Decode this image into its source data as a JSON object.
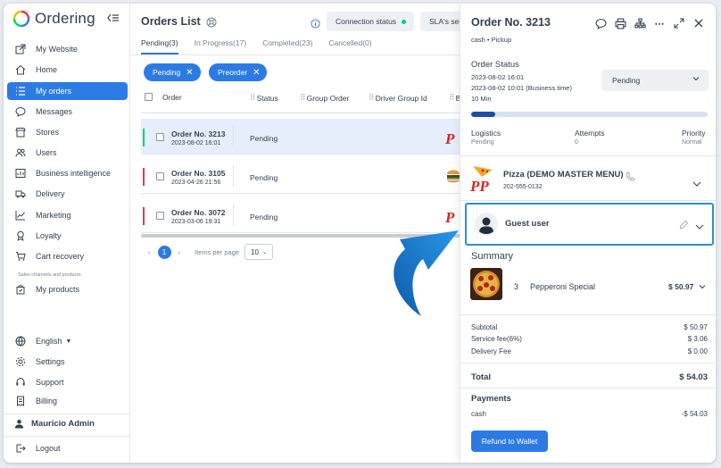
{
  "brand": {
    "name": "Ordering"
  },
  "sidebar": {
    "items": [
      {
        "label": "My Website",
        "icon": "external-link-icon"
      },
      {
        "label": "Home",
        "icon": "home-icon"
      },
      {
        "label": "My orders",
        "icon": "list-icon",
        "active": true
      },
      {
        "label": "Messages",
        "icon": "chat-icon"
      },
      {
        "label": "Stores",
        "icon": "shop-icon"
      },
      {
        "label": "Users",
        "icon": "users-icon"
      },
      {
        "label": "Business intelligence",
        "icon": "chart-icon"
      },
      {
        "label": "Delivery",
        "icon": "truck-icon"
      },
      {
        "label": "Marketing",
        "icon": "graph-icon"
      },
      {
        "label": "Loyalty",
        "icon": "award-icon"
      },
      {
        "label": "Cart recovery",
        "icon": "cart-icon"
      }
    ],
    "section_label": "Sales channels and products",
    "products_label": "My products",
    "bottom_items": [
      {
        "label": "English",
        "icon": "globe-icon"
      },
      {
        "label": "Settings",
        "icon": "gear-icon"
      },
      {
        "label": "Support",
        "icon": "headset-icon"
      },
      {
        "label": "Billing",
        "icon": "receipt-icon"
      }
    ],
    "user_name": "Mauricio Admin",
    "logout_label": "Logout"
  },
  "orders": {
    "title": "Orders List",
    "connection_label": "Connection status",
    "sla_label": "SLA's set",
    "tabs": [
      {
        "label": "Pending(3)",
        "active": true
      },
      {
        "label": "In Progress(17)"
      },
      {
        "label": "Completed(23)"
      },
      {
        "label": "Cancelled(0)"
      }
    ],
    "filters": [
      "Pending",
      "Preorder"
    ],
    "columns": [
      "Order",
      "Status",
      "Group Order",
      "Driver Group Id",
      "B"
    ],
    "rows": [
      {
        "number": "Order No. 3213",
        "date": "2023-08-02 16:01",
        "status": "Pending",
        "bar_color": "#00d27a",
        "selected": true
      },
      {
        "number": "Order No. 3105",
        "date": "2023-04-26 21:56",
        "status": "Pending",
        "bar_color": "#e63757",
        "selected": false
      },
      {
        "number": "Order No. 3072",
        "date": "2023-03-06 19:31",
        "status": "Pending",
        "bar_color": "#e63757",
        "selected": false
      }
    ],
    "pagination": {
      "current": "1",
      "items_per_page_label": "Items per page",
      "per_page": "10"
    }
  },
  "details": {
    "title": "Order No. 3213",
    "subtitle": "cash • Pickup",
    "status_label": "Order Status",
    "status_lines": [
      "2023-08-02 16:01",
      "2023-08-02 10:01 (Business time)",
      "10 Min"
    ],
    "status_value": "Pending",
    "progress_fraction": 0.1,
    "logistics_label": "Logistics",
    "logistics_value": "Pending",
    "attempts_label": "Attempts",
    "attempts_value": "0",
    "priority_label": "Priority",
    "priority_value": "Normal",
    "store_name": "Pizza (DEMO MASTER MENU)",
    "store_phone": "202-555-0132",
    "customer_name": "Guest user",
    "summary_label": "Summary",
    "product": {
      "qty": "3",
      "name": "Pepperoni Special",
      "price": "$ 50.97"
    },
    "subtotal_label": "Subtotal",
    "subtotal_value": "$ 50.97",
    "service_fee_label": "Service fee(6%)",
    "service_fee_value": "$ 3.06",
    "delivery_fee_label": "Delivery Fee",
    "delivery_fee_value": "$ 0.00",
    "total_label": "Total",
    "total_value": "$ 54.03",
    "payments_label": "Payments",
    "payment_method": "cash",
    "payment_value": "-$ 54.03",
    "refund_label": "Refund to Wallet"
  },
  "colors": {
    "accent": "#2c7be5",
    "arrow": "#1d7fd6",
    "highlight_border": "#2b8fd6"
  }
}
